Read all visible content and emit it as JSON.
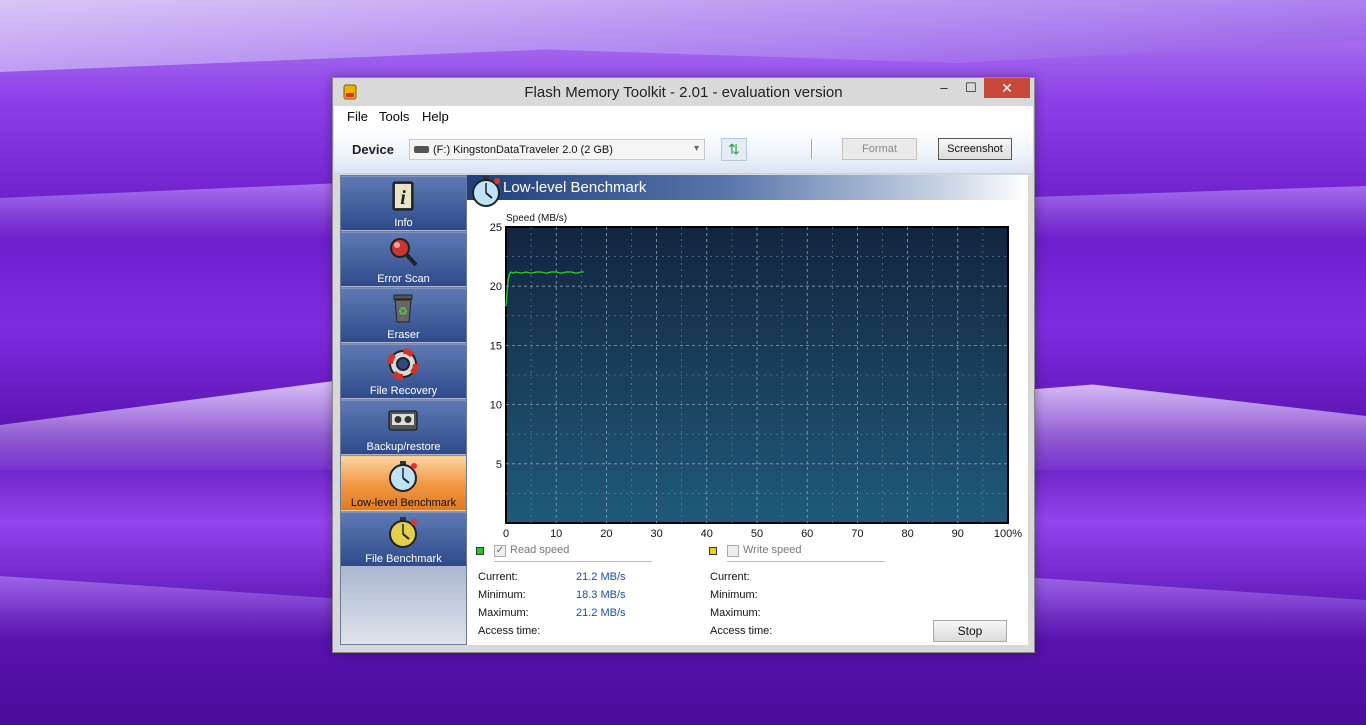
{
  "window": {
    "title": "Flash Memory Toolkit - 2.01 - evaluation version",
    "minimize": "–",
    "maximize": "☐",
    "close": "✕"
  },
  "menu": [
    "File",
    "Tools",
    "Help"
  ],
  "device_bar": {
    "label": "Device",
    "selected_device": "(F:) KingstonDataTraveler 2.0 (2 GB)",
    "format_button": "Format",
    "screenshot_button": "Screenshot"
  },
  "sidebar": {
    "items": [
      {
        "label": "Info",
        "icon": "info-icon"
      },
      {
        "label": "Error Scan",
        "icon": "magnifier-icon"
      },
      {
        "label": "Eraser",
        "icon": "recycle-bin-icon"
      },
      {
        "label": "File Recovery",
        "icon": "lifebuoy-icon"
      },
      {
        "label": "Backup/restore",
        "icon": "tape-icon"
      },
      {
        "label": "Low-level Benchmark",
        "icon": "stopwatch-icon",
        "active": true
      },
      {
        "label": "File Benchmark",
        "icon": "stopwatch-yellow-icon"
      }
    ]
  },
  "panel": {
    "title": "Low-level Benchmark"
  },
  "chart_data": {
    "type": "line",
    "ylabel": "Speed (MB/s)",
    "ylim": [
      0,
      25
    ],
    "yticks": [
      "5",
      "10",
      "15",
      "20",
      "25"
    ],
    "xlim": [
      0,
      100
    ],
    "xticks": [
      "0",
      "10",
      "20",
      "30",
      "40",
      "50",
      "60",
      "70",
      "80",
      "90",
      "100%"
    ],
    "grid": true,
    "series": [
      {
        "color": "#2fd12f",
        "x": [
          0,
          0.2,
          0.4,
          0.6,
          0.8,
          1,
          1.5,
          2,
          3,
          4,
          5,
          6,
          7,
          8,
          9,
          10,
          11,
          12,
          13,
          14,
          15,
          15.5
        ],
        "y": [
          18.3,
          19.5,
          20.4,
          20.9,
          21.1,
          21.2,
          21.1,
          21.2,
          21.1,
          21.2,
          21.1,
          21.2,
          21.2,
          21.1,
          21.2,
          21.2,
          21.1,
          21.2,
          21.2,
          21.1,
          21.2,
          21.2
        ]
      }
    ]
  },
  "read": {
    "swatch_color": "#22cc22",
    "label": "Read speed",
    "current_label": "Current:",
    "current": "21.2 MB/s",
    "minimum_label": "Minimum:",
    "minimum": "18.3 MB/s",
    "maximum_label": "Maximum:",
    "maximum": "21.2 MB/s",
    "access_label": "Access time:"
  },
  "write": {
    "swatch_color": "#e8d020",
    "label": "Write speed",
    "current_label": "Current:",
    "minimum_label": "Minimum:",
    "maximum_label": "Maximum:",
    "access_label": "Access time:"
  },
  "stop_button": "Stop"
}
